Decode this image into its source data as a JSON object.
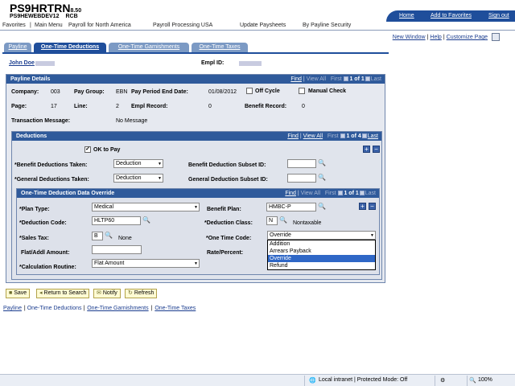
{
  "header": {
    "title": "PS9HRTRN",
    "version": "8.50",
    "db": "PS9HEWEBDEV12",
    "env": "RCB",
    "links": [
      "Home",
      "Add to Favorites",
      "Sign out"
    ]
  },
  "breadcrumb": [
    "Favorites",
    "Main Menu",
    "Payroll for North America",
    "Payroll Processing USA",
    "Update Paysheets",
    "By Payline Security"
  ],
  "page_links": {
    "new_window": "New Window",
    "help": "Help",
    "customize": "Customize Page"
  },
  "tabs": [
    "Payline",
    "One-Time Deductions",
    "One-Time Garnishments",
    "One-Time Taxes"
  ],
  "employee": {
    "name": "John Doe",
    "empl_id_label": "Empl ID:"
  },
  "payline_details": {
    "heading": "Payline Details",
    "nav": {
      "find": "Find",
      "view_all": "View All",
      "first": "First",
      "count": "1 of 1",
      "last": "Last"
    },
    "company_label": "Company:",
    "company": "003",
    "paygroup_label": "Pay Group:",
    "paygroup": "EBN",
    "period_label": "Pay Period End Date:",
    "period": "01/08/2012",
    "off_cycle": "Off Cycle",
    "manual_check": "Manual Check",
    "page_label": "Page:",
    "page": "17",
    "line_label": "Line:",
    "line": "2",
    "empl_record_label": "Empl Record:",
    "empl_record": "0",
    "benefit_record_label": "Benefit Record:",
    "benefit_record": "0",
    "txn_label": "Transaction Message:",
    "txn": "No Message"
  },
  "deductions": {
    "heading": "Deductions",
    "nav": {
      "find": "Find",
      "view_all": "View All",
      "first": "First",
      "count": "1 of 4",
      "last": "Last"
    },
    "ok_to_pay": "OK to Pay",
    "benefit_taken_label": "*Benefit Deductions Taken:",
    "benefit_taken": "Deduction",
    "general_taken_label": "*General Deductions Taken:",
    "general_taken": "Deduction",
    "benefit_subset_label": "Benefit Deduction Subset ID:",
    "general_subset_label": "General Deduction Subset ID:"
  },
  "override": {
    "heading": "One-Time Deduction Data Override",
    "nav": {
      "find": "Find",
      "view_all": "View All",
      "first": "First",
      "count": "1 of 1",
      "last": "Last"
    },
    "plan_type_label": "*Plan Type:",
    "plan_type": "Medical",
    "benefit_plan_label": "Benefit Plan:",
    "benefit_plan": "HMBC-P",
    "ded_code_label": "*Deduction Code:",
    "ded_code": "HLTP60",
    "ded_class_label": "*Deduction Class:",
    "ded_class": "N",
    "ded_class_desc": "Nontaxable",
    "sales_tax_label": "*Sales Tax:",
    "sales_tax": "B",
    "sales_tax_desc": "None",
    "one_time_code_label": "*One Time Code:",
    "one_time_code": "Override",
    "flat_amt_label": "Flat/Addl Amount:",
    "rate_label": "Rate/Percent:",
    "calc_label": "*Calculation Routine:",
    "calc": "Flat Amount",
    "one_time_options": [
      "Addition",
      "Arrears Payback",
      "Override",
      "Refund"
    ]
  },
  "buttons": [
    "Save",
    "Return to Search",
    "Notify",
    "Refresh"
  ],
  "footer_links": [
    "Payline",
    "One-Time Deductions",
    "One-Time Garnishments",
    "One-Time Taxes"
  ],
  "status": {
    "zone": "Local intranet | Protected Mode: Off",
    "zoom": "100%"
  }
}
